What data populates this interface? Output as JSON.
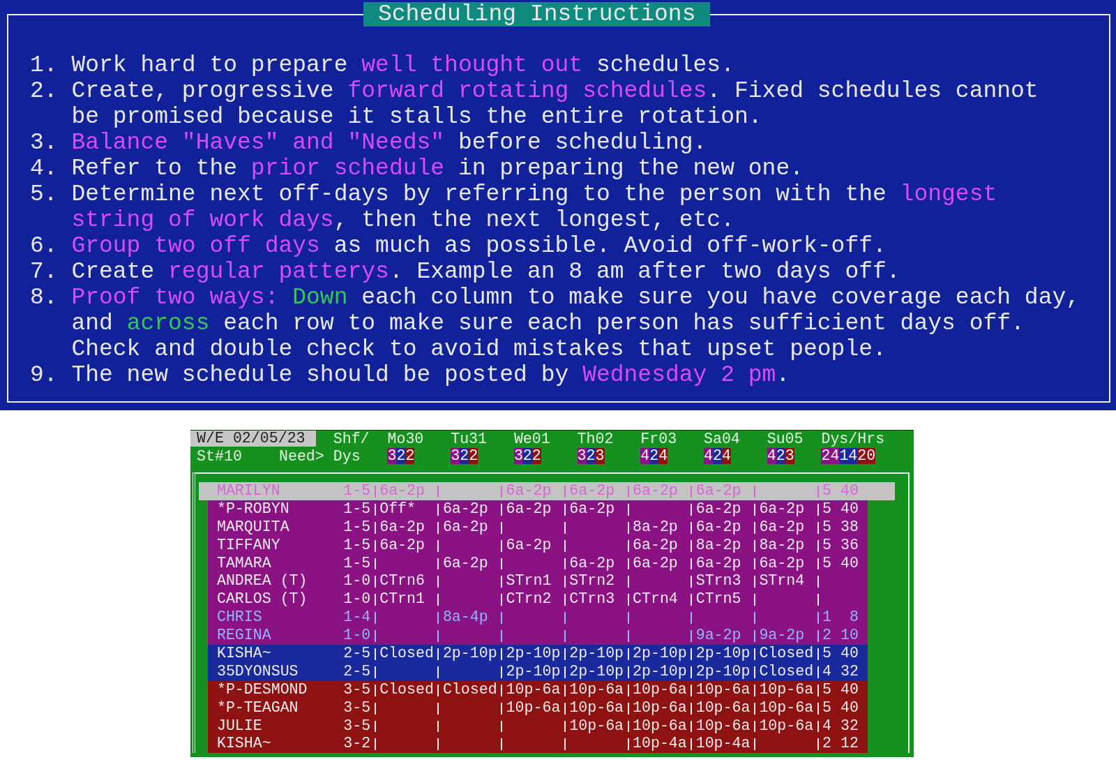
{
  "instructions": {
    "title": "Scheduling Instructions",
    "items": [
      {
        "number": "1.",
        "lines": [
          [
            {
              "text": "Work hard to prepare ",
              "kind": "plain"
            },
            {
              "text": "well thought out",
              "kind": "emphasis"
            },
            {
              "text": " schedules.",
              "kind": "plain"
            }
          ]
        ]
      },
      {
        "number": "2.",
        "lines": [
          [
            {
              "text": "Create, progressive ",
              "kind": "plain"
            },
            {
              "text": "forward rotating schedules",
              "kind": "emphasis"
            },
            {
              "text": ". Fixed schedules cannot",
              "kind": "plain"
            }
          ],
          [
            {
              "text": "be promised because it stalls the entire rotation.",
              "kind": "plain"
            }
          ]
        ]
      },
      {
        "number": "3.",
        "lines": [
          [
            {
              "text": "Balance \"Haves\" and \"Needs\"",
              "kind": "emphasis"
            },
            {
              "text": " before scheduling.",
              "kind": "plain"
            }
          ]
        ]
      },
      {
        "number": "4.",
        "lines": [
          [
            {
              "text": "Refer to the ",
              "kind": "plain"
            },
            {
              "text": "prior schedule",
              "kind": "emphasis"
            },
            {
              "text": " in preparing the new one.",
              "kind": "plain"
            }
          ]
        ]
      },
      {
        "number": "5.",
        "lines": [
          [
            {
              "text": "Determine next off-days by referring to the person with the ",
              "kind": "plain"
            },
            {
              "text": "longest",
              "kind": "emphasis"
            }
          ],
          [
            {
              "text": "string of work days",
              "kind": "emphasis"
            },
            {
              "text": ", then the next longest, etc.",
              "kind": "plain"
            }
          ]
        ]
      },
      {
        "number": "6.",
        "lines": [
          [
            {
              "text": "Group two off days",
              "kind": "emphasis"
            },
            {
              "text": " as much as possible. Avoid off-work-off.",
              "kind": "plain"
            }
          ]
        ]
      },
      {
        "number": "7.",
        "lines": [
          [
            {
              "text": "Create ",
              "kind": "plain"
            },
            {
              "text": "regular patterys",
              "kind": "emphasis"
            },
            {
              "text": ". Example an 8 am after two days off.",
              "kind": "plain"
            }
          ]
        ]
      },
      {
        "number": "8.",
        "lines": [
          [
            {
              "text": "Proof two ways: ",
              "kind": "emphasis"
            },
            {
              "text": "Down",
              "kind": "direction"
            },
            {
              "text": " each column to make sure you have coverage each day,",
              "kind": "plain"
            }
          ],
          [
            {
              "text": "and ",
              "kind": "plain"
            },
            {
              "text": "across",
              "kind": "direction"
            },
            {
              "text": " each row to make sure each person has sufficient days off.",
              "kind": "plain"
            }
          ],
          [
            {
              "text": "Check and double check to avoid mistakes that upset people.",
              "kind": "plain"
            }
          ]
        ]
      },
      {
        "number": "9.",
        "lines": [
          [
            {
              "text": "The new schedule should be posted by ",
              "kind": "plain"
            },
            {
              "text": "Wednesday 2 pm",
              "kind": "emphasis"
            },
            {
              "text": ".",
              "kind": "plain"
            }
          ]
        ]
      }
    ]
  },
  "schedule": {
    "week_ending": "W/E 02/05/23",
    "store": "St#10",
    "shift_header": "Shf/",
    "need_label": "Need>",
    "days_header": "Dys",
    "totals_header": "Dys/Hrs",
    "days": [
      {
        "label": "Mo30",
        "need": [
          {
            "text": "3",
            "color": "#8b1283"
          },
          {
            "text": "2",
            "color": "#1a2a9c"
          },
          {
            "text": "2",
            "color": "#8f1212"
          }
        ]
      },
      {
        "label": "Tu31",
        "need": [
          {
            "text": "3",
            "color": "#8b1283"
          },
          {
            "text": "2",
            "color": "#1a2a9c"
          },
          {
            "text": "2",
            "color": "#8f1212"
          }
        ]
      },
      {
        "label": "We01",
        "need": [
          {
            "text": "3",
            "color": "#8b1283"
          },
          {
            "text": "2",
            "color": "#1a2a9c"
          },
          {
            "text": "2",
            "color": "#8f1212"
          }
        ]
      },
      {
        "label": "Th02",
        "need": [
          {
            "text": "3",
            "color": "#8b1283"
          },
          {
            "text": "2",
            "color": "#1a2a9c"
          },
          {
            "text": "3",
            "color": "#8f1212"
          }
        ]
      },
      {
        "label": "Fr03",
        "need": [
          {
            "text": "4",
            "color": "#8b1283"
          },
          {
            "text": "2",
            "color": "#1a2a9c"
          },
          {
            "text": "4",
            "color": "#8f1212"
          }
        ]
      },
      {
        "label": "Sa04",
        "need": [
          {
            "text": "4",
            "color": "#8b1283"
          },
          {
            "text": "2",
            "color": "#1a2a9c"
          },
          {
            "text": "4",
            "color": "#8f1212"
          }
        ]
      },
      {
        "label": "Su05",
        "need": [
          {
            "text": "4",
            "color": "#8b1283"
          },
          {
            "text": "2",
            "color": "#1a2a9c"
          },
          {
            "text": "3",
            "color": "#8f1212"
          }
        ]
      }
    ],
    "totals_need": [
      {
        "text": "24",
        "color": "#8b1283"
      },
      {
        "text": "14",
        "color": "#1a2a9c"
      },
      {
        "text": "20",
        "color": "#8f1212"
      }
    ],
    "rows": [
      {
        "name": "MARILYN",
        "shift": "1-5",
        "selected": true,
        "kind": "regular",
        "cells": [
          "6a-2p",
          null,
          "6a-2p",
          "6a-2p",
          "6a-2p",
          "6a-2p",
          null
        ],
        "dys": "5",
        "hrs": "40"
      },
      {
        "name": "*P-ROBYN",
        "shift": "1-5",
        "selected": false,
        "kind": "regular",
        "color": "#8b1283",
        "cells": [
          "Off*",
          "6a-2p",
          "6a-2p",
          "6a-2p",
          null,
          "6a-2p",
          "6a-2p"
        ],
        "dys": "5",
        "hrs": "40"
      },
      {
        "name": "MARQUITA",
        "shift": "1-5",
        "selected": false,
        "kind": "regular",
        "color": "#8b1283",
        "cells": [
          "6a-2p",
          "6a-2p",
          null,
          null,
          "8a-2p",
          "6a-2p",
          "6a-2p"
        ],
        "dys": "5",
        "hrs": "38"
      },
      {
        "name": "TIFFANY",
        "shift": "1-5",
        "selected": false,
        "kind": "regular",
        "color": "#8b1283",
        "cells": [
          "6a-2p",
          null,
          "6a-2p",
          null,
          "6a-2p",
          "8a-2p",
          "8a-2p"
        ],
        "dys": "5",
        "hrs": "36"
      },
      {
        "name": "TAMARA",
        "shift": "1-5",
        "selected": false,
        "kind": "regular",
        "color": "#8b1283",
        "cells": [
          null,
          "6a-2p",
          null,
          "6a-2p",
          "6a-2p",
          "6a-2p",
          "6a-2p"
        ],
        "dys": "5",
        "hrs": "40"
      },
      {
        "name": "ANDREA (T)",
        "shift": "1-0",
        "selected": false,
        "kind": "regular",
        "color": "#8b1283",
        "cells": [
          "CTrn6",
          null,
          "STrn1",
          "STrn2",
          null,
          "STrn3",
          "STrn4"
        ],
        "dys": null,
        "hrs": null
      },
      {
        "name": "CARLOS (T)",
        "shift": "1-0",
        "selected": false,
        "kind": "regular",
        "color": "#8b1283",
        "cells": [
          "CTrn1",
          null,
          "CTrn2",
          "CTrn3",
          "CTrn4",
          "CTrn5",
          null
        ],
        "dys": null,
        "hrs": null
      },
      {
        "name": "CHRIS",
        "shift": "1-4",
        "selected": false,
        "kind": "part_time",
        "color": "#8b1283",
        "cells": [
          null,
          "8a-4p",
          null,
          null,
          null,
          null,
          null
        ],
        "dys": "1",
        "hrs": "8"
      },
      {
        "name": "REGINA",
        "shift": "1-0",
        "selected": false,
        "kind": "part_time",
        "color": "#8b1283",
        "cells": [
          null,
          null,
          null,
          null,
          null,
          "9a-2p",
          "9a-2p"
        ],
        "dys": "2",
        "hrs": "10"
      },
      {
        "name": "KISHA~",
        "shift": "2-5",
        "selected": false,
        "kind": "regular",
        "color": "#1a2a9c",
        "cells": [
          "Closed",
          "2p-10p",
          "2p-10p",
          "2p-10p",
          "2p-10p",
          "2p-10p",
          "Closed"
        ],
        "dys": "5",
        "hrs": "40"
      },
      {
        "name": "35DYONSUS",
        "shift": "2-5",
        "selected": false,
        "kind": "regular",
        "color": "#1a2a9c",
        "cells": [
          null,
          null,
          "2p-10p",
          "2p-10p",
          "2p-10p",
          "2p-10p",
          "Closed"
        ],
        "dys": "4",
        "hrs": "32"
      },
      {
        "name": "*P-DESMOND",
        "shift": "3-5",
        "selected": false,
        "kind": "regular",
        "color": "#8f1212",
        "cells": [
          "Closed",
          "Closed",
          "10p-6a",
          "10p-6a",
          "10p-6a",
          "10p-6a",
          "10p-6a"
        ],
        "dys": "5",
        "hrs": "40"
      },
      {
        "name": "*P-TEAGAN",
        "shift": "3-5",
        "selected": false,
        "kind": "regular",
        "color": "#8f1212",
        "cells": [
          null,
          null,
          "10p-6a",
          "10p-6a",
          "10p-6a",
          "10p-6a",
          "10p-6a"
        ],
        "dys": "5",
        "hrs": "40"
      },
      {
        "name": "JULIE",
        "shift": "3-5",
        "selected": false,
        "kind": "regular",
        "color": "#8f1212",
        "cells": [
          null,
          null,
          null,
          "10p-6a",
          "10p-6a",
          "10p-6a",
          "10p-6a"
        ],
        "dys": "4",
        "hrs": "32"
      },
      {
        "name": "KISHA~",
        "shift": "3-2",
        "selected": false,
        "kind": "regular",
        "color": "#8f1212",
        "cells": [
          null,
          null,
          null,
          null,
          "10p-4a",
          "10p-4a",
          null
        ],
        "dys": "2",
        "hrs": "12"
      }
    ]
  }
}
